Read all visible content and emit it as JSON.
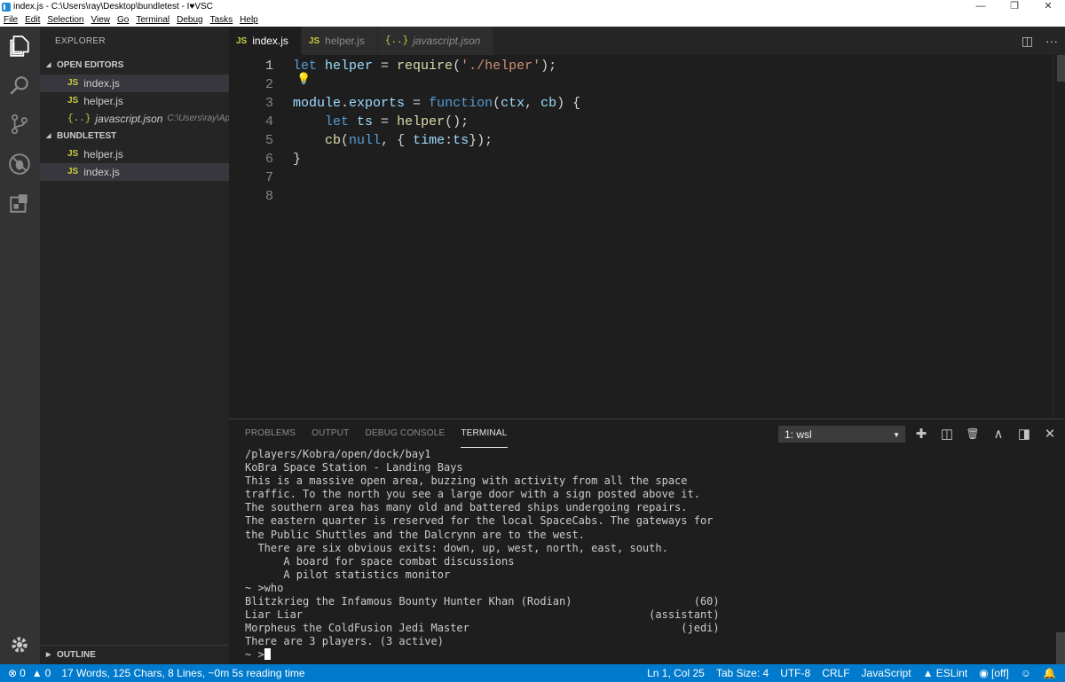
{
  "window": {
    "title": "index.js - C:\\Users\\ray\\Desktop\\bundletest - I♥VSC",
    "controls": [
      "—",
      "❐",
      "✕"
    ]
  },
  "menu": [
    "File",
    "Edit",
    "Selection",
    "View",
    "Go",
    "Terminal",
    "Debug",
    "Tasks",
    "Help"
  ],
  "activity": [
    "files-icon",
    "search-icon",
    "source-control-icon",
    "debug-icon",
    "extensions-icon",
    "settings-icon"
  ],
  "sidebar": {
    "title": "EXPLORER",
    "open_editors": {
      "label": "OPEN EDITORS",
      "items": [
        {
          "icon": "JS",
          "name": "index.js",
          "path": ""
        },
        {
          "icon": "JS",
          "name": "helper.js",
          "path": ""
        },
        {
          "icon": "{..}",
          "name": "javascript.json",
          "path": "C:\\Users\\ray\\App..."
        }
      ]
    },
    "folder": {
      "label": "BUNDLETEST",
      "items": [
        {
          "icon": "JS",
          "name": "helper.js"
        },
        {
          "icon": "JS",
          "name": "index.js"
        }
      ]
    },
    "outline": "OUTLINE"
  },
  "tabs": [
    {
      "icon": "JS",
      "label": "index.js"
    },
    {
      "icon": "JS",
      "label": "helper.js"
    },
    {
      "icon": "{..}",
      "label": "javascript.json"
    }
  ],
  "tab_actions": [
    "◫",
    "···"
  ],
  "editor": {
    "line_numbers": [
      "1",
      "2",
      "3",
      "4",
      "5",
      "6",
      "7",
      "8"
    ],
    "lines": [
      [
        {
          "t": "let ",
          "c": "kw"
        },
        {
          "t": "helper",
          "c": "var"
        },
        {
          "t": " = ",
          "c": ""
        },
        {
          "t": "require",
          "c": "fn"
        },
        {
          "t": "(",
          "c": ""
        },
        {
          "t": "'./helper'",
          "c": "str"
        },
        {
          "t": ");",
          "c": ""
        }
      ],
      [],
      [
        {
          "t": "module",
          "c": "var"
        },
        {
          "t": ".",
          "c": ""
        },
        {
          "t": "exports",
          "c": "var"
        },
        {
          "t": " = ",
          "c": ""
        },
        {
          "t": "function",
          "c": "kw"
        },
        {
          "t": "(",
          "c": ""
        },
        {
          "t": "ctx",
          "c": "var"
        },
        {
          "t": ", ",
          "c": ""
        },
        {
          "t": "cb",
          "c": "var"
        },
        {
          "t": ") {",
          "c": ""
        }
      ],
      [
        {
          "t": "    ",
          "c": ""
        },
        {
          "t": "let ",
          "c": "kw"
        },
        {
          "t": "ts",
          "c": "var"
        },
        {
          "t": " = ",
          "c": ""
        },
        {
          "t": "helper",
          "c": "fn"
        },
        {
          "t": "();",
          "c": ""
        }
      ],
      [
        {
          "t": "    ",
          "c": ""
        },
        {
          "t": "cb",
          "c": "fn"
        },
        {
          "t": "(",
          "c": ""
        },
        {
          "t": "null",
          "c": "kw"
        },
        {
          "t": ", { ",
          "c": ""
        },
        {
          "t": "time",
          "c": "var"
        },
        {
          "t": ":",
          "c": ""
        },
        {
          "t": "ts",
          "c": "var"
        },
        {
          "t": "});",
          "c": ""
        }
      ],
      [
        {
          "t": "}",
          "c": ""
        }
      ],
      [],
      []
    ],
    "hint_icon": "lightbulb-icon"
  },
  "panel": {
    "tabs": [
      "PROBLEMS",
      "OUTPUT",
      "DEBUG CONSOLE",
      "TERMINAL"
    ],
    "active_tab": "TERMINAL",
    "terminal_select": "1: wsl",
    "actions": [
      "✚",
      "◫",
      "🗑",
      "∧",
      "◨",
      "✕"
    ],
    "terminal_lines": [
      "/players/Kobra/open/dock/bay1",
      "KoBra Space Station - Landing Bays",
      "This is a massive open area, buzzing with activity from all the space",
      "traffic. To the north you see a large door with a sign posted above it.",
      "The southern area has many old and battered ships undergoing repairs.",
      "The eastern quarter is reserved for the local SpaceCabs. The gateways for",
      "the Public Shuttles and the Dalcrynn are to the west.",
      "  There are six obvious exits: down, up, west, north, east, south.",
      "      A board for space combat discussions",
      "      A pilot statistics monitor",
      "~ >who",
      "Blitzkrieg the Infamous Bounty Hunter Khan (Rodian)                   (60)",
      "Liar Liar                                                      (assistant)",
      "Morpheus the ColdFusion Jedi Master                                 (jedi)",
      "There are 3 players. (3 active)"
    ],
    "prompt": "~ >"
  },
  "status": {
    "errors": "0",
    "warnings": "0",
    "stats": "17 Words, 125 Chars, 8 Lines, ~0m 5s reading time",
    "position": "Ln 1, Col 25",
    "tab_size": "Tab Size: 4",
    "encoding": "UTF-8",
    "eol": "CRLF",
    "language": "JavaScript",
    "eslint": "ESLint",
    "live": "[off]"
  }
}
